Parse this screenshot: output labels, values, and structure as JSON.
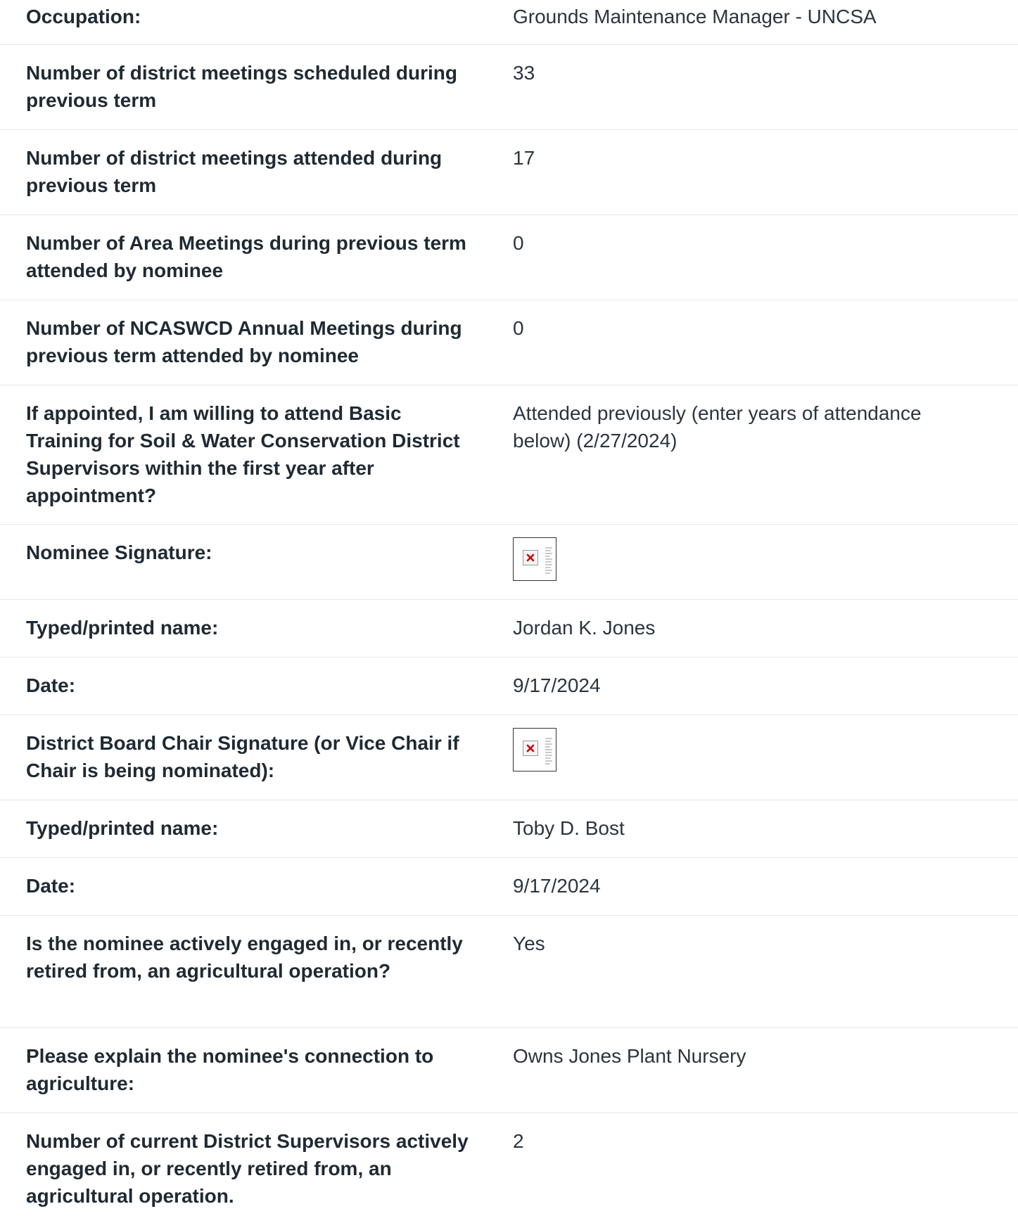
{
  "rows": [
    {
      "label": "Occupation:",
      "value": "Grounds Maintenance Manager - UNCSA"
    },
    {
      "label": "Number of district meetings scheduled during previous term",
      "value": "33"
    },
    {
      "label": "Number of district meetings attended during previous term",
      "value": "17"
    },
    {
      "label": "Number of Area Meetings during previous term attended by nominee",
      "value": "0"
    },
    {
      "label": "Number of NCASWCD Annual Meetings during previous term attended by nominee",
      "value": "0"
    },
    {
      "label": "If appointed, I am willing to attend Basic Training for Soil & Water Conservation District Supervisors within the first year after appointment?",
      "value": "Attended previously (enter years of attendance below) (2/27/2024)"
    },
    {
      "label": "Nominee Signature:",
      "value": "",
      "icon": "broken-image-icon"
    },
    {
      "label": "Typed/printed name:",
      "value": "Jordan K. Jones"
    },
    {
      "label": "Date:",
      "value": "9/17/2024"
    },
    {
      "label": "District Board Chair Signature (or Vice Chair if Chair is being nominated):",
      "value": "",
      "icon": "broken-image-icon"
    },
    {
      "label": "Typed/printed name:",
      "value": "Toby D. Bost"
    },
    {
      "label": "Date:",
      "value": "9/17/2024"
    },
    {
      "label": "Is the nominee actively engaged in, or recently retired from, an agricultural operation?",
      "value": "Yes"
    },
    {
      "label": "Please explain the nominee's connection to agriculture:",
      "value": "Owns Jones Plant Nursery"
    },
    {
      "label": "Number of current District Supervisors actively engaged in, or recently retired from, an agricultural operation.",
      "value": "2"
    }
  ],
  "colors": {
    "text": "#1f2a33",
    "divider": "#e4e6e8",
    "broken_image_x": "#cc0000"
  }
}
